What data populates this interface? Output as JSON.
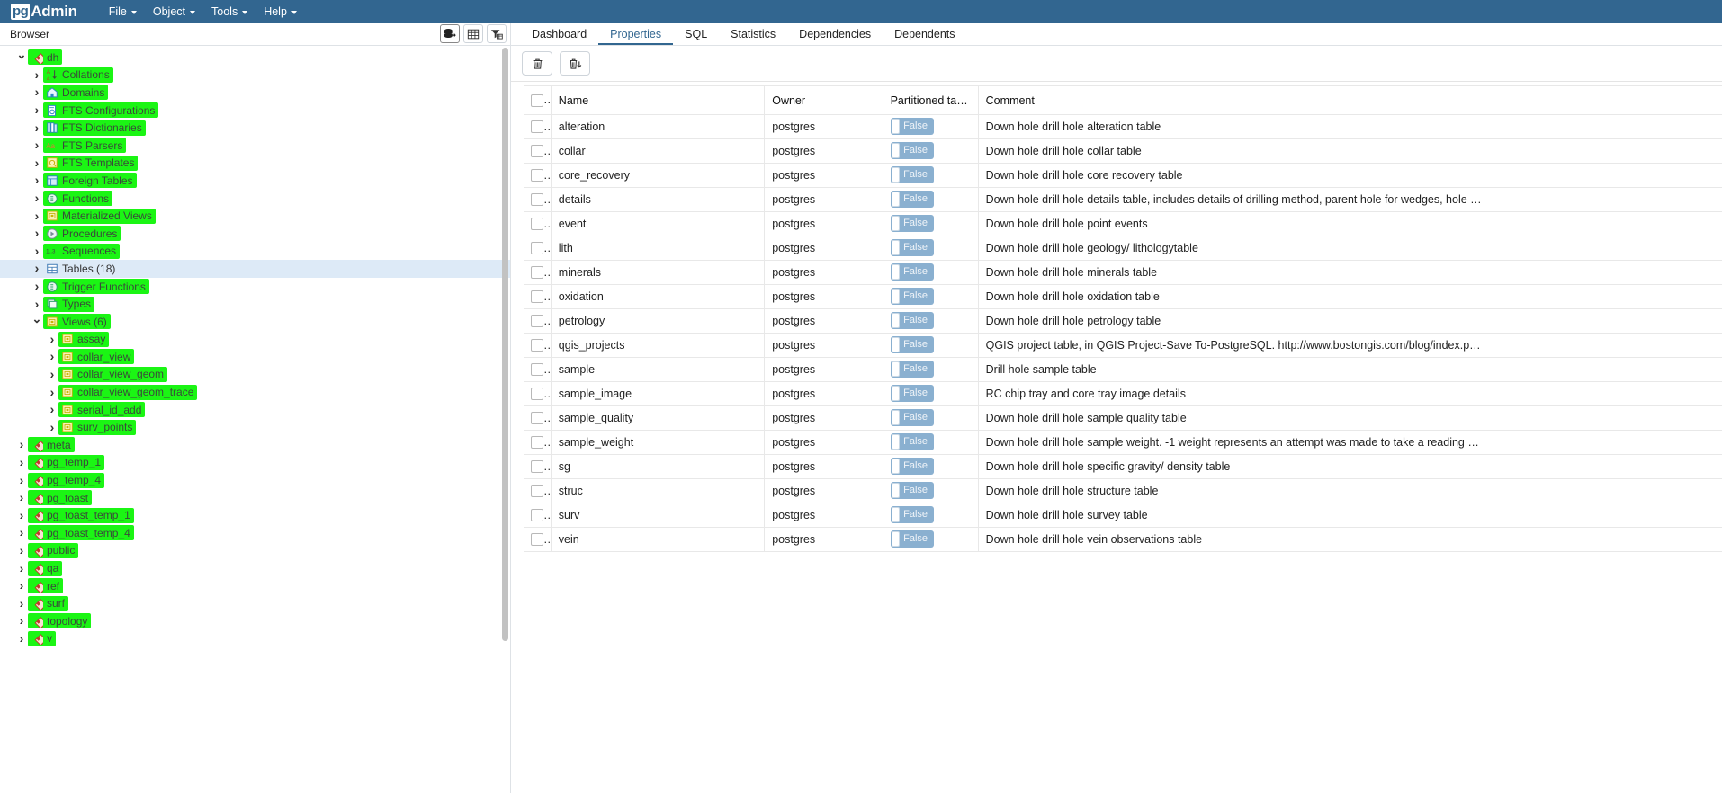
{
  "app": {
    "brand_pg": "pg",
    "brand_admin": "Admin",
    "menus": [
      {
        "label": "File"
      },
      {
        "label": "Object"
      },
      {
        "label": "Tools"
      },
      {
        "label": "Help"
      }
    ]
  },
  "browser": {
    "title": "Browser",
    "tools": [
      {
        "name": "object-explorer-icon",
        "title": "Object Explorer"
      },
      {
        "name": "grid-view-icon",
        "title": "Grid"
      },
      {
        "name": "filter-icon",
        "title": "Filter"
      }
    ]
  },
  "tabs": [
    {
      "label": "Dashboard",
      "active": false
    },
    {
      "label": "Properties",
      "active": true
    },
    {
      "label": "SQL",
      "active": false
    },
    {
      "label": "Statistics",
      "active": false
    },
    {
      "label": "Dependencies",
      "active": false
    },
    {
      "label": "Dependents",
      "active": false
    }
  ],
  "action_bar": {
    "delete_label": "",
    "delete_title": "Delete",
    "download_title": "Download"
  },
  "tree": [
    {
      "indent": 1,
      "arrow": "open",
      "label": "dh",
      "icon": "database-icon",
      "highlight": true,
      "selected": false
    },
    {
      "indent": 2,
      "arrow": "closed",
      "label": "Collations",
      "icon": "collation-icon",
      "highlight": true,
      "selected": false
    },
    {
      "indent": 2,
      "arrow": "closed",
      "label": "Domains",
      "icon": "domain-icon",
      "highlight": true,
      "selected": false
    },
    {
      "indent": 2,
      "arrow": "closed",
      "label": "FTS Configurations",
      "icon": "fts-config-icon",
      "highlight": true,
      "selected": false
    },
    {
      "indent": 2,
      "arrow": "closed",
      "label": "FTS Dictionaries",
      "icon": "fts-dict-icon",
      "highlight": true,
      "selected": false
    },
    {
      "indent": 2,
      "arrow": "closed",
      "label": "FTS Parsers",
      "icon": "fts-parser-icon",
      "highlight": true,
      "selected": false
    },
    {
      "indent": 2,
      "arrow": "closed",
      "label": "FTS Templates",
      "icon": "fts-template-icon",
      "highlight": true,
      "selected": false
    },
    {
      "indent": 2,
      "arrow": "closed",
      "label": "Foreign Tables",
      "icon": "foreign-table-icon",
      "highlight": true,
      "selected": false
    },
    {
      "indent": 2,
      "arrow": "closed",
      "label": "Functions",
      "icon": "function-icon",
      "highlight": true,
      "selected": false
    },
    {
      "indent": 2,
      "arrow": "closed",
      "label": "Materialized Views",
      "icon": "matview-icon",
      "highlight": true,
      "selected": false
    },
    {
      "indent": 2,
      "arrow": "closed",
      "label": "Procedures",
      "icon": "procedure-icon",
      "highlight": true,
      "selected": false
    },
    {
      "indent": 2,
      "arrow": "closed",
      "label": "Sequences",
      "icon": "sequence-icon",
      "highlight": true,
      "selected": false
    },
    {
      "indent": 2,
      "arrow": "closed",
      "label": "Tables (18)",
      "icon": "table-icon",
      "highlight": false,
      "selected": true
    },
    {
      "indent": 2,
      "arrow": "closed",
      "label": "Trigger Functions",
      "icon": "trigger-func-icon",
      "highlight": true,
      "selected": false
    },
    {
      "indent": 2,
      "arrow": "closed",
      "label": "Types",
      "icon": "type-icon",
      "highlight": true,
      "selected": false
    },
    {
      "indent": 2,
      "arrow": "open",
      "label": "Views (6)",
      "icon": "view-icon",
      "highlight": true,
      "selected": false
    },
    {
      "indent": 3,
      "arrow": "closed",
      "label": "assay",
      "icon": "view-icon",
      "highlight": true,
      "selected": false
    },
    {
      "indent": 3,
      "arrow": "closed",
      "label": "collar_view",
      "icon": "view-icon",
      "highlight": true,
      "selected": false
    },
    {
      "indent": 3,
      "arrow": "closed",
      "label": "collar_view_geom",
      "icon": "view-icon",
      "highlight": true,
      "selected": false
    },
    {
      "indent": 3,
      "arrow": "closed",
      "label": "collar_view_geom_trace",
      "icon": "view-icon",
      "highlight": true,
      "selected": false
    },
    {
      "indent": 3,
      "arrow": "closed",
      "label": "serial_id_add",
      "icon": "view-icon",
      "highlight": true,
      "selected": false
    },
    {
      "indent": 3,
      "arrow": "closed",
      "label": "surv_points",
      "icon": "view-icon",
      "highlight": true,
      "selected": false
    },
    {
      "indent": 1,
      "arrow": "closed",
      "label": "meta",
      "icon": "schema-icon",
      "highlight": true,
      "selected": false
    },
    {
      "indent": 1,
      "arrow": "closed",
      "label": "pg_temp_1",
      "icon": "schema-icon",
      "highlight": true,
      "selected": false
    },
    {
      "indent": 1,
      "arrow": "closed",
      "label": "pg_temp_4",
      "icon": "schema-icon",
      "highlight": true,
      "selected": false
    },
    {
      "indent": 1,
      "arrow": "closed",
      "label": "pg_toast",
      "icon": "schema-icon",
      "highlight": true,
      "selected": false
    },
    {
      "indent": 1,
      "arrow": "closed",
      "label": "pg_toast_temp_1",
      "icon": "schema-icon",
      "highlight": true,
      "selected": false
    },
    {
      "indent": 1,
      "arrow": "closed",
      "label": "pg_toast_temp_4",
      "icon": "schema-icon",
      "highlight": true,
      "selected": false
    },
    {
      "indent": 1,
      "arrow": "closed",
      "label": "public",
      "icon": "schema-icon",
      "highlight": true,
      "selected": false
    },
    {
      "indent": 1,
      "arrow": "closed",
      "label": "qa",
      "icon": "schema-icon",
      "highlight": true,
      "selected": false
    },
    {
      "indent": 1,
      "arrow": "closed",
      "label": "ref",
      "icon": "schema-icon",
      "highlight": true,
      "selected": false
    },
    {
      "indent": 1,
      "arrow": "closed",
      "label": "surf",
      "icon": "schema-icon",
      "highlight": true,
      "selected": false
    },
    {
      "indent": 1,
      "arrow": "closed",
      "label": "topology",
      "icon": "schema-icon",
      "highlight": true,
      "selected": false
    },
    {
      "indent": 1,
      "arrow": "closed",
      "label": "v",
      "icon": "schema-icon",
      "highlight": true,
      "selected": false
    }
  ],
  "grid": {
    "columns": [
      "Name",
      "Owner",
      "Partitioned table?",
      "Comment"
    ],
    "rows": [
      {
        "name": "alteration",
        "owner": "postgres",
        "partitioned": "False",
        "comment": "Down hole drill hole alteration table"
      },
      {
        "name": "collar",
        "owner": "postgres",
        "partitioned": "False",
        "comment": "Down hole drill hole collar table"
      },
      {
        "name": "core_recovery",
        "owner": "postgres",
        "partitioned": "False",
        "comment": "Down hole drill hole core recovery table"
      },
      {
        "name": "details",
        "owner": "postgres",
        "partitioned": "False",
        "comment": "Down hole drill hole details table, includes details of drilling method, parent hole for wedges, hole …"
      },
      {
        "name": "event",
        "owner": "postgres",
        "partitioned": "False",
        "comment": "Down hole drill hole point events"
      },
      {
        "name": "lith",
        "owner": "postgres",
        "partitioned": "False",
        "comment": "Down hole drill hole geology/ lithologytable"
      },
      {
        "name": "minerals",
        "owner": "postgres",
        "partitioned": "False",
        "comment": "Down hole drill hole minerals table"
      },
      {
        "name": "oxidation",
        "owner": "postgres",
        "partitioned": "False",
        "comment": "Down hole drill hole oxidation table"
      },
      {
        "name": "petrology",
        "owner": "postgres",
        "partitioned": "False",
        "comment": "Down hole drill hole petrology table"
      },
      {
        "name": "qgis_projects",
        "owner": "postgres",
        "partitioned": "False",
        "comment": "QGIS project table, in QGIS Project-Save To-PostgreSQL. http://www.bostongis.com/blog/index.p…"
      },
      {
        "name": "sample",
        "owner": "postgres",
        "partitioned": "False",
        "comment": "Drill hole sample table"
      },
      {
        "name": "sample_image",
        "owner": "postgres",
        "partitioned": "False",
        "comment": "RC chip tray and core tray image details"
      },
      {
        "name": "sample_quality",
        "owner": "postgres",
        "partitioned": "False",
        "comment": "Down hole drill hole sample quality table"
      },
      {
        "name": "sample_weight",
        "owner": "postgres",
        "partitioned": "False",
        "comment": "Down hole drill hole sample weight. -1 weight represents an attempt was made to take a reading …"
      },
      {
        "name": "sg",
        "owner": "postgres",
        "partitioned": "False",
        "comment": "Down hole drill hole specific gravity/ density table"
      },
      {
        "name": "struc",
        "owner": "postgres",
        "partitioned": "False",
        "comment": "Down hole drill hole structure table"
      },
      {
        "name": "surv",
        "owner": "postgres",
        "partitioned": "False",
        "comment": "Down hole drill hole survey table"
      },
      {
        "name": "vein",
        "owner": "postgres",
        "partitioned": "False",
        "comment": "Down hole drill hole vein observations table"
      }
    ]
  },
  "colors": {
    "brand": "#326690",
    "highlight": "#1bf514",
    "selection": "#ddeaf7",
    "switch": "#8ab0d0"
  }
}
